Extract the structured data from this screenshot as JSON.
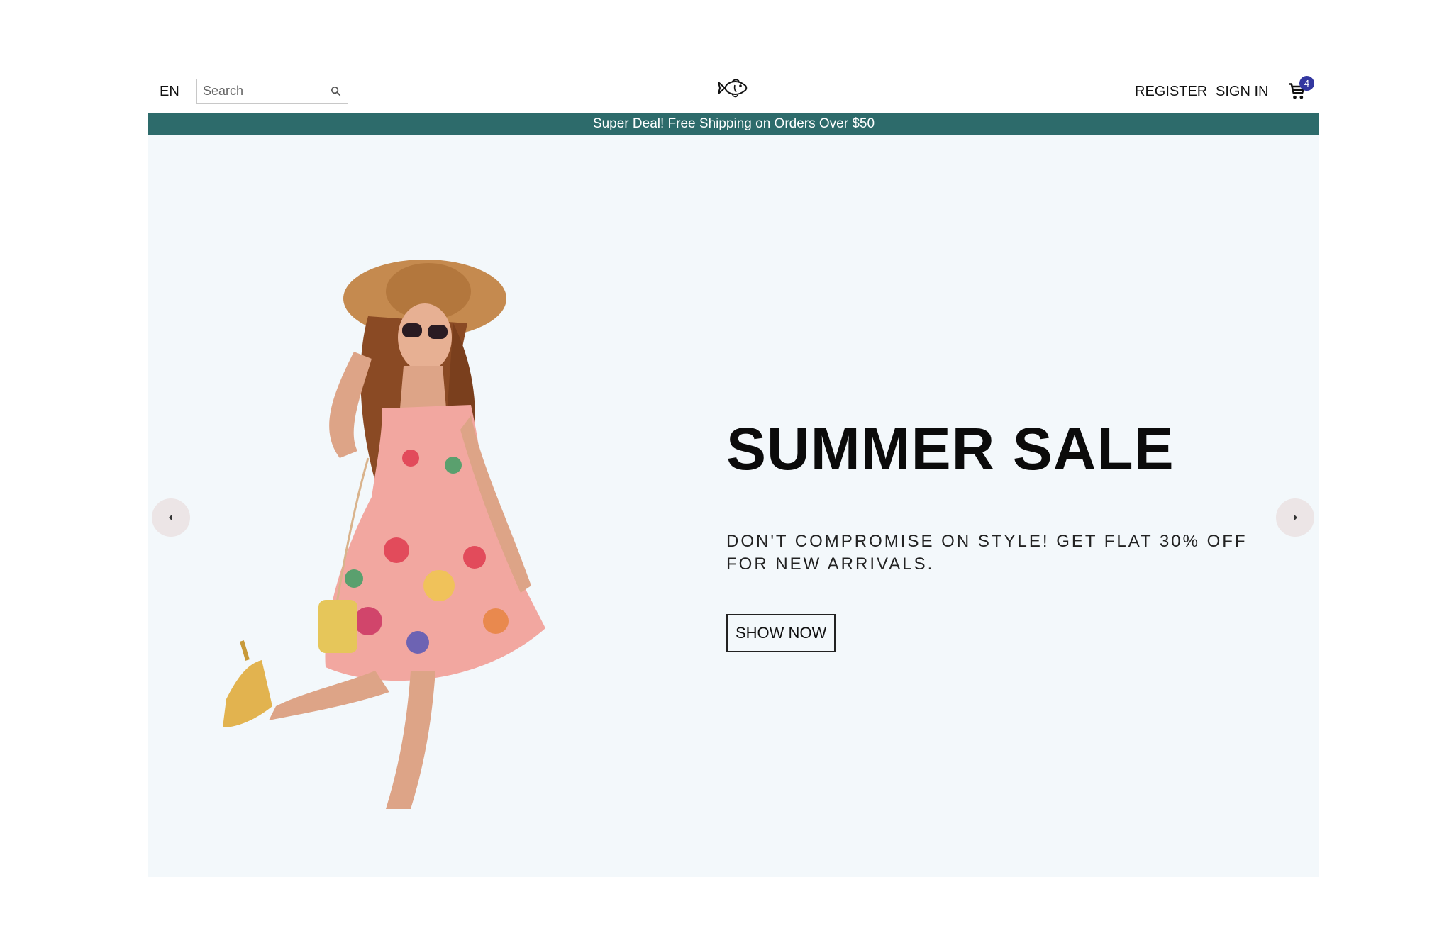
{
  "navbar": {
    "language": "EN",
    "search_placeholder": "Search",
    "register_label": "REGISTER",
    "signin_label": "SIGN IN",
    "cart_count": "4"
  },
  "announcement": {
    "text": "Super Deal! Free Shipping on Orders Over $50"
  },
  "hero": {
    "title": "SUMMER SALE",
    "description": "DON'T COMPROMISE ON STYLE! GET FLAT 30% OFF FOR NEW ARRIVALS.",
    "button_label": "SHOW NOW"
  },
  "colors": {
    "announcement_bg": "#2d6b6b",
    "hero_bg": "#f3f8fb",
    "badge_bg": "#3337a0",
    "arrow_bg": "#ece5e6"
  },
  "icons": [
    "search-icon",
    "fish-logo-icon",
    "cart-icon",
    "arrow-left-icon",
    "arrow-right-icon"
  ]
}
